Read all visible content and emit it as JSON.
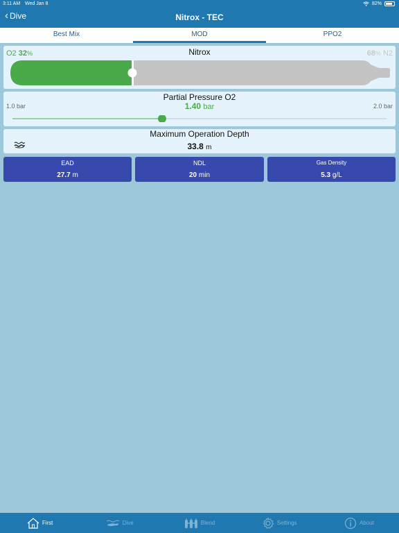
{
  "status": {
    "time": "3:11 AM",
    "date": "Wed Jan 8",
    "battery": "82%"
  },
  "nav": {
    "back_label": "Dive",
    "title": "Nitrox - TEC"
  },
  "tabs": [
    {
      "label": "Best Mix",
      "active": false
    },
    {
      "label": "MOD",
      "active": true
    },
    {
      "label": "PPO2",
      "active": false
    }
  ],
  "mix": {
    "title": "Nitrox",
    "o2_label": "O2",
    "o2_value": "32",
    "n2_label": "N2",
    "n2_value": "68",
    "percent_unit": "%",
    "o2_fraction": 0.32,
    "o2_color": "#4aaa4a",
    "n2_color": "#c4c4c4"
  },
  "partial_pressure": {
    "title": "Partial Pressure O2",
    "min_label": "1.0 bar",
    "max_label": "2.0 bar",
    "value": "1.40",
    "unit": "bar",
    "min": 1.0,
    "max": 2.0,
    "current": 1.4
  },
  "mod": {
    "title": "Maximum Operation Depth",
    "value": "33.8",
    "unit": "m",
    "icon": "wave-icon"
  },
  "stats": [
    {
      "label": "EAD",
      "value": "27.7",
      "unit": "m"
    },
    {
      "label": "NDL",
      "value": "20",
      "unit": "min"
    },
    {
      "label": "Gas Density",
      "value": "5.3",
      "unit": "g/L"
    }
  ],
  "bottom_tabs": [
    {
      "label": "First",
      "icon": "home-icon"
    },
    {
      "label": "Dive",
      "icon": "diver-icon"
    },
    {
      "label": "Blend",
      "icon": "tanks-icon"
    },
    {
      "label": "Settings",
      "icon": "gear-icon"
    },
    {
      "label": "About",
      "icon": "info-icon"
    }
  ]
}
